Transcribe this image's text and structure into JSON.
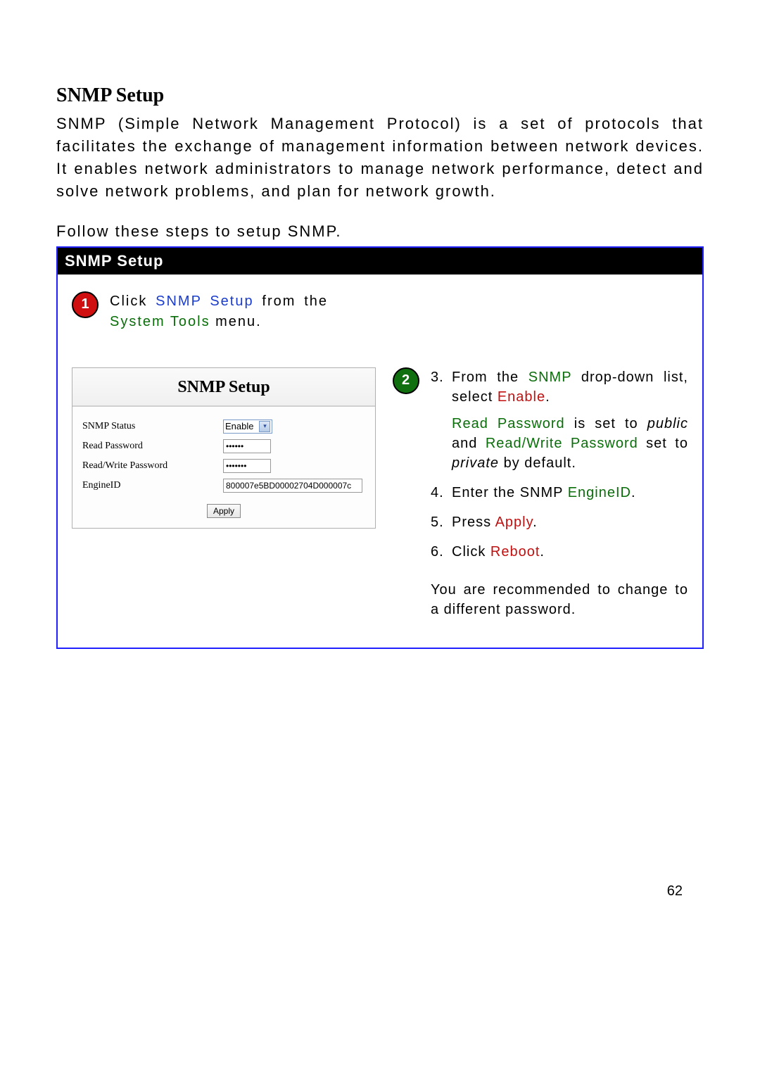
{
  "title": "SNMP Setup",
  "intro": "SNMP (Simple Network Management Protocol) is a set of protocols that facilitates the exchange of management information between network devices. It enables network administrators to manage network performance, detect and solve network problems, and plan for network growth.",
  "follow": "Follow these steps to setup SNMP.",
  "panel_header": "SNMP Setup",
  "step1": {
    "num": "1",
    "prefix": "Click ",
    "link": "SNMP Setup",
    "mid": " from the ",
    "menu": "System Tools",
    "suffix": " menu."
  },
  "form": {
    "title": "SNMP Setup",
    "labels": {
      "status": "SNMP Status",
      "read_pw": "Read Password",
      "rw_pw": "Read/Write Password",
      "engine": "EngineID"
    },
    "values": {
      "status_select": "Enable",
      "read_pw": "••••••",
      "rw_pw": "•••••••",
      "engine": "800007e5BD00002704D000007c"
    },
    "apply": "Apply"
  },
  "step2": {
    "num": "2",
    "items": {
      "3": {
        "num": "3.",
        "p1_a": "From the ",
        "p1_b": "SNMP",
        "p1_c": " drop-down list, select ",
        "p1_d": "Enable",
        "p1_e": ".",
        "p2_a": "Read Password",
        "p2_b": " is set to ",
        "p2_c": "public",
        "p2_d": " and ",
        "p2_e": "Read/Write Password",
        "p2_f": " set to ",
        "p2_g": "private",
        "p2_h": " by default."
      },
      "4": {
        "num": "4.",
        "a": "Enter the SNMP ",
        "b": "EngineID",
        "c": "."
      },
      "5": {
        "num": "5.",
        "a": "Press ",
        "b": "Apply",
        "c": "."
      },
      "6": {
        "num": "6.",
        "a": "Click ",
        "b": "Reboot",
        "c": "."
      }
    },
    "note": "You are recommended to change to a different password."
  },
  "page_number": "62"
}
